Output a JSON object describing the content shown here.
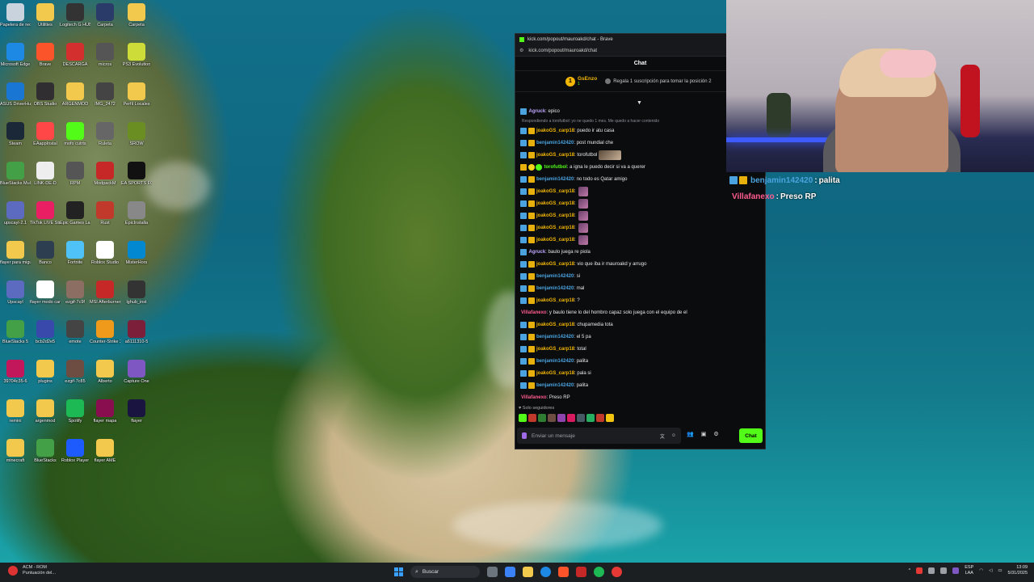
{
  "desktop": {
    "icons": [
      {
        "label": "Papelera de reciclaje",
        "icon": "recycle-bin-icon",
        "color": "#c8d3dd"
      },
      {
        "label": "Utilities",
        "icon": "folder-icon",
        "color": "#f2c94c"
      },
      {
        "label": "Logitech G HUB",
        "icon": "logitech-icon",
        "color": "#333333"
      },
      {
        "label": "Carpeta",
        "icon": "folder-icon",
        "color": "#2a3b6a"
      },
      {
        "label": "Carpeta",
        "icon": "folder-icon",
        "color": "#f2c94c"
      },
      {
        "label": "Microsoft Edge",
        "icon": "edge-icon",
        "color": "#1e88e5"
      },
      {
        "label": "Brave",
        "icon": "brave-icon",
        "color": "#fb542b"
      },
      {
        "label": "DESCARGA",
        "icon": "pdf-icon",
        "color": "#d32f2f"
      },
      {
        "label": "micros",
        "icon": "app-icon",
        "color": "#555555"
      },
      {
        "label": "PS3 Evolution",
        "icon": "app-icon",
        "color": "#cddc39"
      },
      {
        "label": "ASUS DriverHub",
        "icon": "asus-icon",
        "color": "#1976d2"
      },
      {
        "label": "OBS Studio",
        "icon": "obs-icon",
        "color": "#302e31"
      },
      {
        "label": "ARGENMOD",
        "icon": "folder-icon",
        "color": "#f2c94c"
      },
      {
        "label": "IMG_2472",
        "icon": "image-icon",
        "color": "#444444"
      },
      {
        "label": "Perfil Locales",
        "icon": "folder-icon",
        "color": "#f2c94c"
      },
      {
        "label": "Steam",
        "icon": "steam-icon",
        "color": "#1b2838"
      },
      {
        "label": "EAappInstal",
        "icon": "ea-icon",
        "color": "#ff4747"
      },
      {
        "label": "mofo cutrts",
        "icon": "app-icon",
        "color": "#53fc18"
      },
      {
        "label": "Ruleta",
        "icon": "app-icon",
        "color": "#666666"
      },
      {
        "label": "SROW",
        "icon": "app-icon",
        "color": "#6b8e23"
      },
      {
        "label": "BlueStacks Multi-Insta",
        "icon": "bluestacks-icon",
        "color": "#43a047"
      },
      {
        "label": "LINK-DE-D",
        "icon": "file-icon",
        "color": "#eeeeee"
      },
      {
        "label": "RPM",
        "icon": "app-icon",
        "color": "#555555"
      },
      {
        "label": "ModpackM",
        "icon": "app-icon",
        "color": "#c62828"
      },
      {
        "label": "EA SPORTS FC 25",
        "icon": "game-icon",
        "color": "#111111"
      },
      {
        "label": "upscayl-2.1",
        "icon": "upscayl-icon",
        "color": "#5c6bc0"
      },
      {
        "label": "TikTok LIVE Studio",
        "icon": "tiktok-icon",
        "color": "#e91e63"
      },
      {
        "label": "Epic Games Launcher",
        "icon": "epic-icon",
        "color": "#222222"
      },
      {
        "label": "Rust",
        "icon": "rust-icon",
        "color": "#c0392b"
      },
      {
        "label": "EpicInstalla",
        "icon": "app-icon",
        "color": "#888888"
      },
      {
        "label": "flayer para miguel",
        "icon": "folder-icon",
        "color": "#f2c94c"
      },
      {
        "label": "Banco",
        "icon": "app-icon",
        "color": "#2c3e50"
      },
      {
        "label": "Fortnite",
        "icon": "fortnite-icon",
        "color": "#4fc3f7"
      },
      {
        "label": "Roblox Studio",
        "icon": "roblox-icon",
        "color": "#ffffff"
      },
      {
        "label": "MisterHors",
        "icon": "app-icon",
        "color": "#0288d1"
      },
      {
        "label": "Upscayl",
        "icon": "upscayl-icon",
        "color": "#5c6bc0"
      },
      {
        "label": "flayer modo carrera",
        "icon": "file-icon",
        "color": "#ffffff"
      },
      {
        "label": "ezgif-7c9f",
        "icon": "image-icon",
        "color": "#8d6e63"
      },
      {
        "label": "MSI Afterburner",
        "icon": "msi-icon",
        "color": "#c62828"
      },
      {
        "label": "lghub_inst",
        "icon": "logitech-icon",
        "color": "#333333"
      },
      {
        "label": "BlueStacks 5",
        "icon": "bluestacks-icon",
        "color": "#43a047"
      },
      {
        "label": "bcb2d2e5",
        "icon": "image-icon",
        "color": "#3949ab"
      },
      {
        "label": "emote",
        "icon": "image-icon",
        "color": "#444444"
      },
      {
        "label": "Counter-Strike 2",
        "icon": "cs-icon",
        "color": "#ef9a1a"
      },
      {
        "label": "a6111310-5",
        "icon": "image-icon",
        "color": "#7b1f3a"
      },
      {
        "label": "39704c35-6",
        "icon": "image-icon",
        "color": "#c2185b"
      },
      {
        "label": "plugins",
        "icon": "folder-icon",
        "color": "#f2c94c"
      },
      {
        "label": "ezgif-7c85",
        "icon": "image-icon",
        "color": "#6d4c41"
      },
      {
        "label": "Alberto",
        "icon": "folder-icon",
        "color": "#f2c94c"
      },
      {
        "label": "Capture One",
        "icon": "app-icon",
        "color": "#7e57c2"
      },
      {
        "label": "remini",
        "icon": "folder-icon",
        "color": "#f2c94c"
      },
      {
        "label": "argenmod",
        "icon": "folder-icon",
        "color": "#f2c94c"
      },
      {
        "label": "Spotify",
        "icon": "spotify-icon",
        "color": "#1db954"
      },
      {
        "label": "flayer mapa",
        "icon": "image-icon",
        "color": "#880e4f"
      },
      {
        "label": "flayer",
        "icon": "ae-icon",
        "color": "#1a1540"
      },
      {
        "label": "minecraft",
        "icon": "folder-icon",
        "color": "#f2c94c"
      },
      {
        "label": "BlueStacks",
        "icon": "bluestacks-icon",
        "color": "#43a047"
      },
      {
        "label": "Roblox Player",
        "icon": "roblox-icon",
        "color": "#1e5bff"
      },
      {
        "label": "flayer AME",
        "icon": "folder-icon",
        "color": "#f2c94c"
      }
    ]
  },
  "browser": {
    "title": "kick.com/popout/mauroakd/chat - Brave",
    "url": "kick.com/popout/mauroakd/chat",
    "minimize": "–"
  },
  "chat": {
    "header": "Chat",
    "pinned": {
      "rank": "1",
      "user": "GsEnzo",
      "count": "1",
      "gift_text": "Regala 1 suscripción para tomar la posición 2"
    },
    "reply_note": "Respondiendo a torofutbol: yo ne quedo 1 mes. Me quedo a hacer contenido",
    "messages": [
      {
        "user": "Agruck",
        "text": "epico",
        "color": "violet",
        "badges": [
          "blue"
        ]
      },
      {
        "user": "joakoGS_carp18",
        "text": "puedo ir atu casa",
        "color": "gold",
        "badges": [
          "blue",
          "gold"
        ],
        "reply": true
      },
      {
        "user": "benjamin142420",
        "text": "post mundial che",
        "color": "blue",
        "badges": [
          "blue",
          "gold"
        ]
      },
      {
        "user": "joakoGS_carp18",
        "text": "torofutbol",
        "color": "gold",
        "badges": [
          "blue",
          "gold"
        ],
        "emote": "wide"
      },
      {
        "user": "torofutbol",
        "text": "a igna le puedo decir si va a querer",
        "color": "green",
        "badges": [
          "gold",
          "yellow",
          "green"
        ]
      },
      {
        "user": "benjamin142420",
        "text": "no todo es Qatar amigo",
        "color": "blue",
        "badges": [
          "blue",
          "gold"
        ]
      },
      {
        "user": "joakoGS_carp18",
        "text": "",
        "color": "gold",
        "badges": [
          "blue",
          "gold"
        ],
        "emote": "square"
      },
      {
        "user": "joakoGS_carp18",
        "text": "",
        "color": "gold",
        "badges": [
          "blue",
          "gold"
        ],
        "emote": "square"
      },
      {
        "user": "joakoGS_carp18",
        "text": "",
        "color": "gold",
        "badges": [
          "blue",
          "gold"
        ],
        "emote": "square"
      },
      {
        "user": "joakoGS_carp18",
        "text": "",
        "color": "gold",
        "badges": [
          "blue",
          "gold"
        ],
        "emote": "square"
      },
      {
        "user": "joakoGS_carp18",
        "text": "",
        "color": "gold",
        "badges": [
          "blue",
          "gold"
        ],
        "emote": "square"
      },
      {
        "user": "Agruck",
        "text": "baulo juega re piola",
        "color": "violet",
        "badges": [
          "blue"
        ]
      },
      {
        "user": "joakoGS_carp18",
        "text": "vio que iba ir mauroakd y arrugo",
        "color": "gold",
        "badges": [
          "blue",
          "gold"
        ]
      },
      {
        "user": "benjamin142420",
        "text": "si",
        "color": "blue",
        "badges": [
          "blue",
          "gold"
        ]
      },
      {
        "user": "benjamin142420",
        "text": "mal",
        "color": "blue",
        "badges": [
          "blue",
          "gold"
        ]
      },
      {
        "user": "joakoGS_carp18",
        "text": "?",
        "color": "gold",
        "badges": [
          "blue",
          "gold"
        ]
      },
      {
        "user": "Villafanexo",
        "text": "y baulo tiene lo del hombro capaz solo juega con el equipo de el",
        "color": "pink",
        "badges": []
      },
      {
        "user": "joakoGS_carp18",
        "text": "chupamedia tota",
        "color": "gold",
        "badges": [
          "blue",
          "gold"
        ]
      },
      {
        "user": "benjamin142420",
        "text": "el 5 pa",
        "color": "blue",
        "badges": [
          "blue",
          "gold"
        ]
      },
      {
        "user": "joakoGS_carp18",
        "text": "total",
        "color": "gold",
        "badges": [
          "blue",
          "gold"
        ]
      },
      {
        "user": "benjamin142420",
        "text": "palita",
        "color": "blue",
        "badges": [
          "blue",
          "gold"
        ]
      },
      {
        "user": "joakoGS_carp18",
        "text": "pala si",
        "color": "gold",
        "badges": [
          "blue",
          "gold"
        ]
      },
      {
        "user": "benjamin142420",
        "text": "palita",
        "color": "blue",
        "badges": [
          "blue",
          "gold"
        ]
      },
      {
        "user": "Villafanexo",
        "text": "Preso RP",
        "color": "pink",
        "badges": []
      }
    ],
    "followers_only": "Solo seguidores",
    "emote_bar": [
      "#53fc18",
      "#c0392b",
      "#2e7d32",
      "#6d4c41",
      "#8e44ad",
      "#d81b60",
      "#455a64",
      "#27ae60",
      "#c0392b",
      "#f1c40f"
    ],
    "input_placeholder": "Enviar un mensaje",
    "send_label": "Chat",
    "colors": {
      "accent": "#53fc18",
      "blue": "#4aa3df",
      "gold": "#f2b705",
      "violet": "#bfa7ff",
      "pink": "#ff5d8f"
    }
  },
  "overlay": {
    "messages": [
      {
        "user": "benjamin142420",
        "text": "palita",
        "color": "#4aa3df"
      },
      {
        "user": "Villafanexo",
        "text": "Preso RP",
        "color": "#ff5d8f"
      }
    ]
  },
  "taskbar": {
    "notification_title": "ACM - ROM",
    "notification_sub": "Puntuación del...",
    "search_label": "Buscar",
    "lang_top": "ESP",
    "lang_bottom": "LAA",
    "time": "13:09",
    "date": "5/31/2025"
  }
}
